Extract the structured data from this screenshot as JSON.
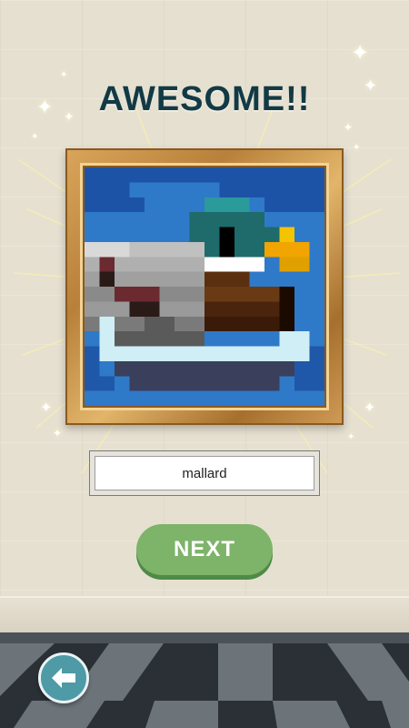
{
  "title": "AWESOME!!",
  "puzzle": {
    "answer": "mallard",
    "image_subject": "mallard-duck-pixel-art"
  },
  "buttons": {
    "next_label": "NEXT",
    "back_icon": "back-arrow-icon"
  },
  "colors": {
    "title": "#123a45",
    "next_button": "#7eb36a",
    "back_button": "#4e9aa6",
    "frame_gold": "#c8903f",
    "wall": "#e6e0d1",
    "floor_dark": "#2a3035",
    "floor_light": "#6d7479"
  }
}
